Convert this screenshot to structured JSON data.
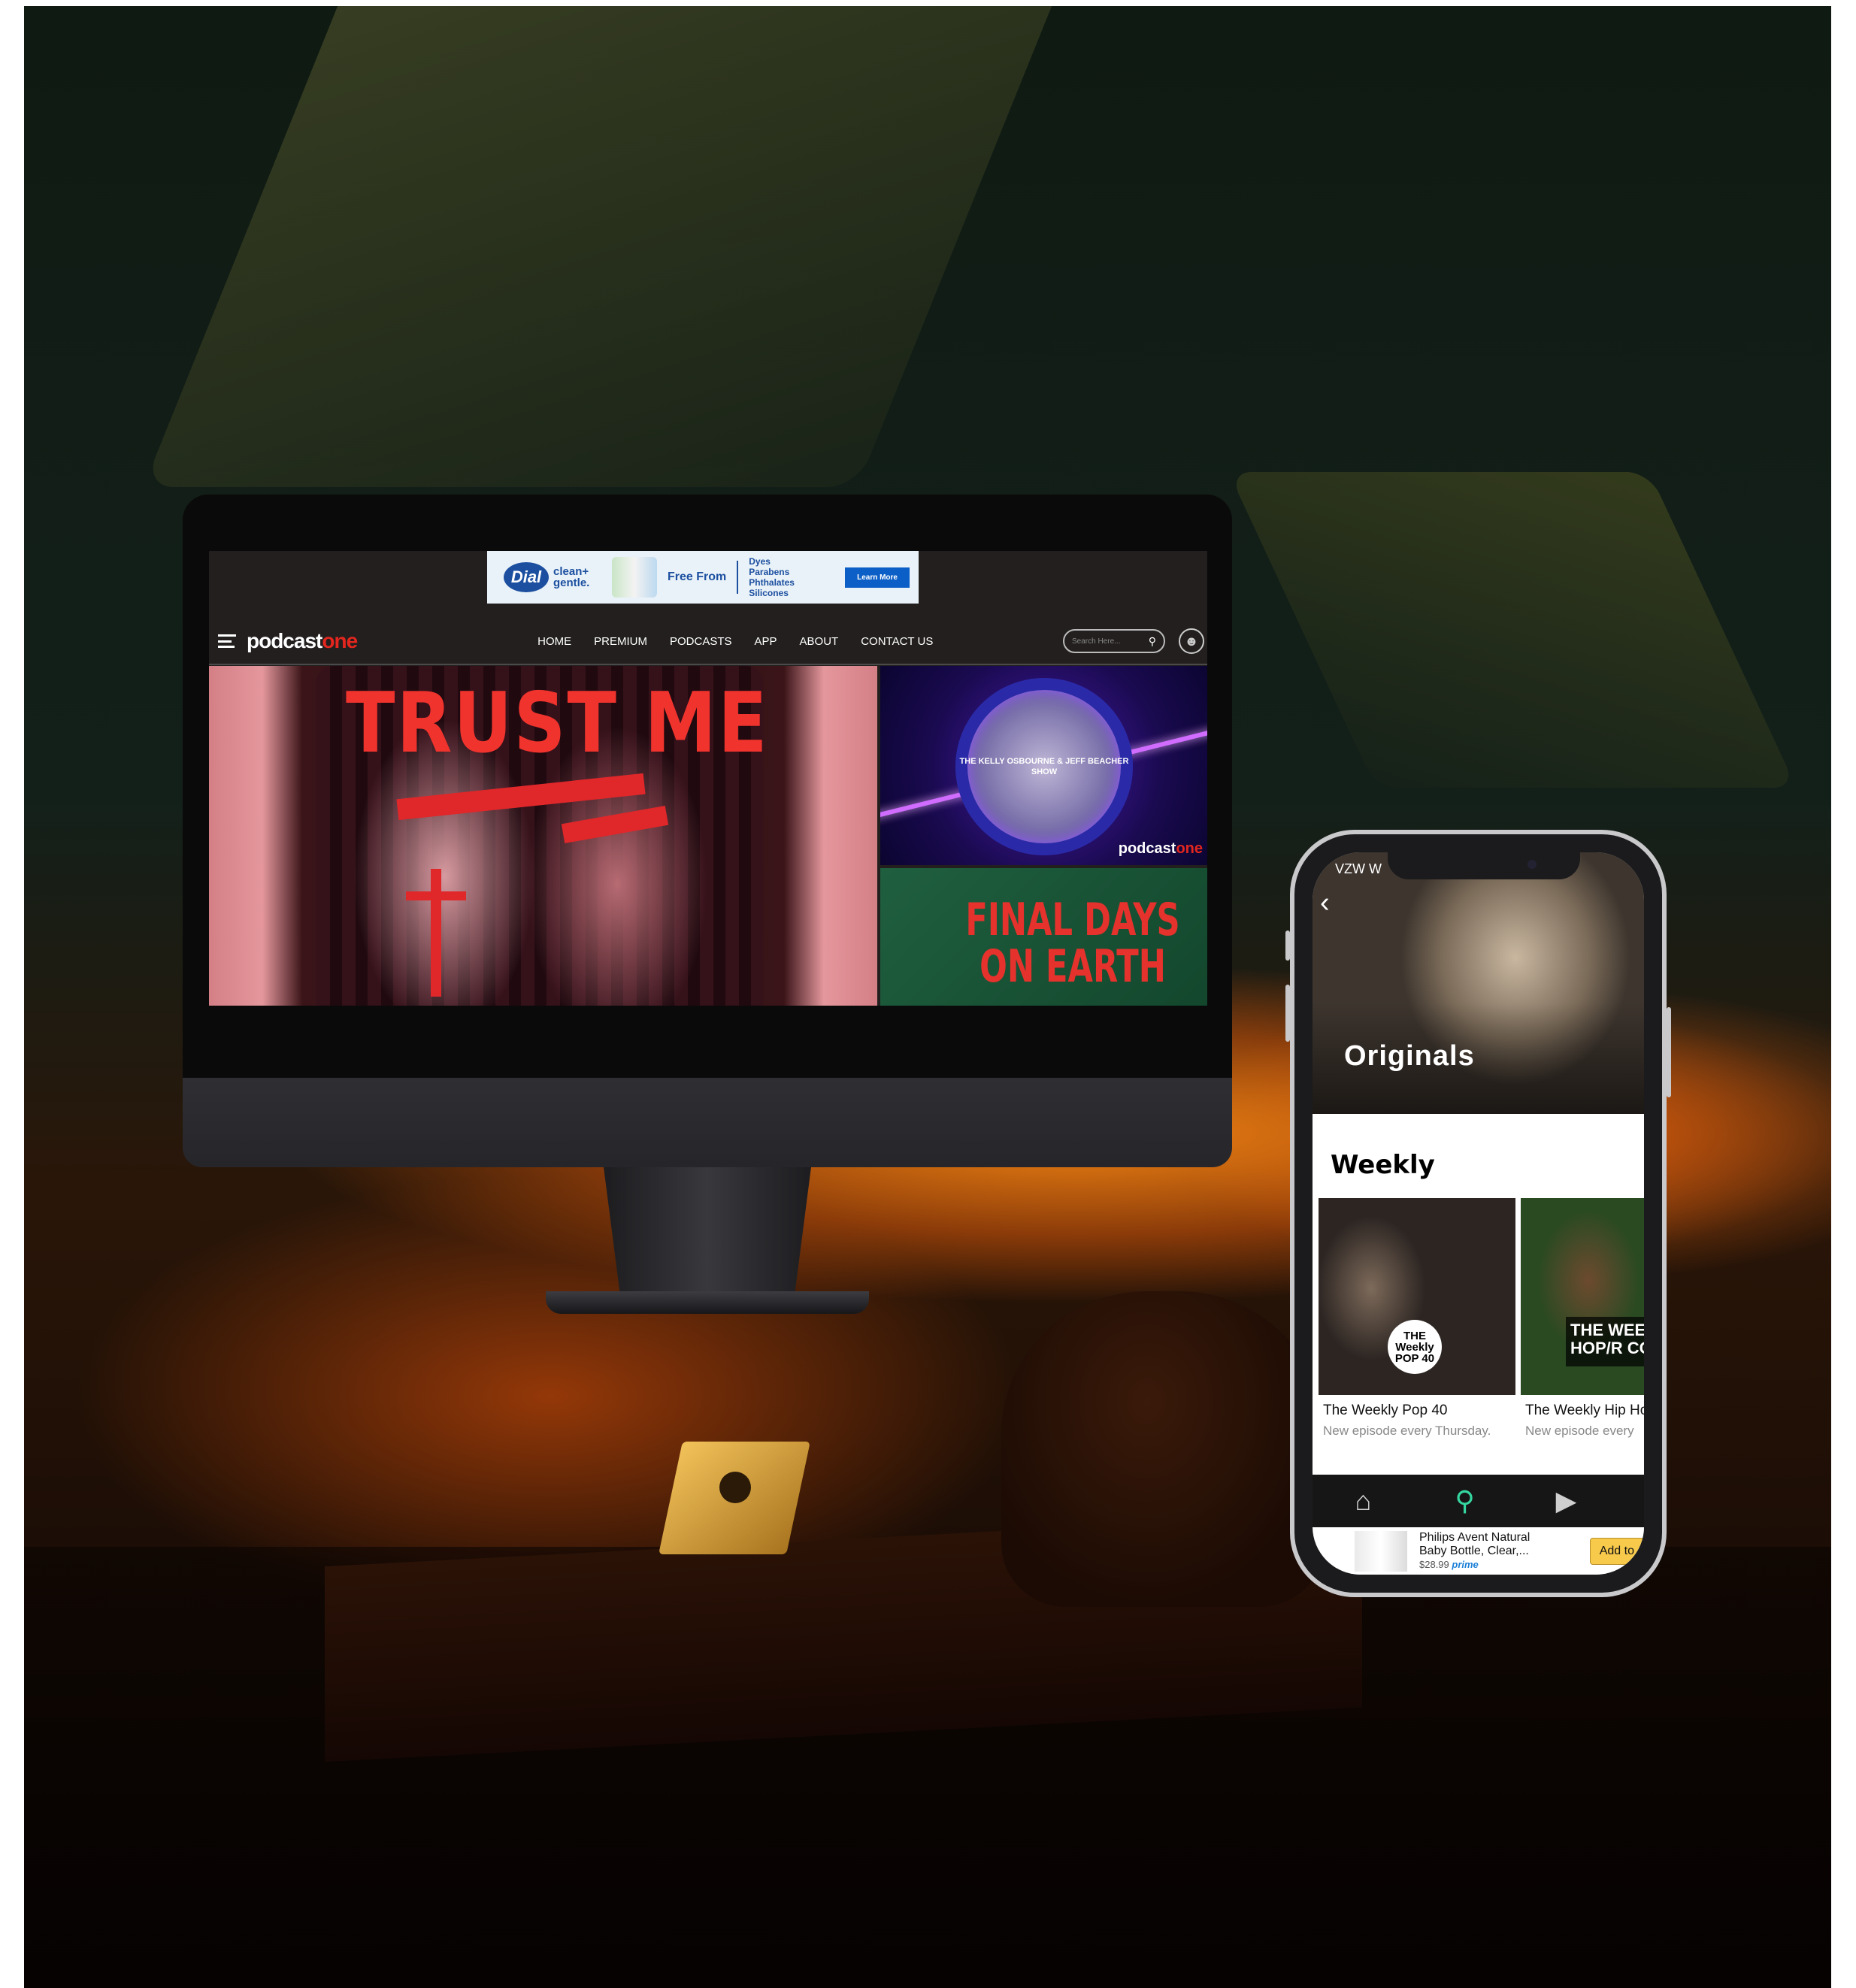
{
  "desktop": {
    "ad": {
      "brand": "Dial",
      "brand_sub": "clean+ gentle.",
      "headline": "Free From",
      "list": [
        "Dyes",
        "Parabens",
        "Phthalates",
        "Silicones"
      ],
      "cta": "Learn More"
    },
    "site": {
      "logo_main": "podcast",
      "logo_accent": "one",
      "nav": [
        "HOME",
        "PREMIUM",
        "PODCASTS",
        "APP",
        "ABOUT",
        "CONTACT US"
      ],
      "search_placeholder": "Search Here..."
    },
    "hero": {
      "main_title": "TRUST ME",
      "top_show": "THE KELLY OSBOURNE & JEFF BEACHER SHOW",
      "top_logo_main": "podcast",
      "top_logo_accent": "one",
      "bottom_title": "FINAL DAYS ON EARTH"
    }
  },
  "phone": {
    "status": {
      "carrier": "VZW W"
    },
    "header_title": "Originals",
    "section_title": "Weekly",
    "cards": [
      {
        "title": "The Weekly Pop 40",
        "subtitle": "New episode every Thursday.",
        "badge": "THE Weekly POP 40"
      },
      {
        "title": "The Weekly Hip Ho",
        "subtitle": "New episode every",
        "badge": "THE WEEK HIP HOP/R COUNTDO"
      }
    ],
    "tabs": [
      "home-icon",
      "search-icon",
      "video-icon"
    ],
    "ad": {
      "product": "Philips Avent Natural Baby Bottle, Clear,...",
      "price": "$28.99",
      "prime": "prime",
      "cta": "Add to"
    }
  },
  "colors": {
    "accent_red": "#e3261e",
    "tab_active": "#35d6a0"
  }
}
